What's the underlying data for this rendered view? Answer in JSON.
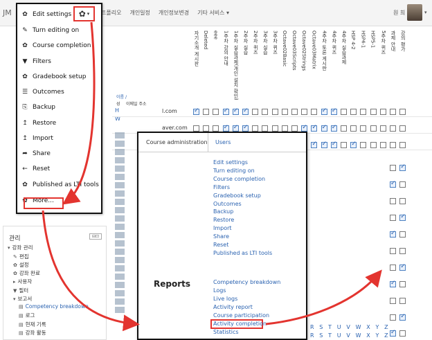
{
  "topbar": {
    "brand": "JM",
    "nav": [
      "트폴리오",
      "개인일정",
      "개인정보변경",
      "기타 서비스 ▾"
    ],
    "user_name": "원 희",
    "caret": "▾"
  },
  "cog_button": {
    "icon": "gear-icon",
    "caret": "▾"
  },
  "cog_menu": [
    {
      "label": "Edit settings",
      "icon": "gear-icon",
      "glyph": "✿"
    },
    {
      "label": "Turn editing on",
      "icon": "pencil-icon",
      "glyph": "✎"
    },
    {
      "label": "Course completion",
      "icon": "gear-icon",
      "glyph": "✿"
    },
    {
      "label": "Filters",
      "icon": "filter-icon",
      "glyph": "▼"
    },
    {
      "label": "Gradebook setup",
      "icon": "gear-icon",
      "glyph": "✿"
    },
    {
      "label": "Outcomes",
      "icon": "list-icon",
      "glyph": "☰"
    },
    {
      "label": "Backup",
      "icon": "document-icon",
      "glyph": "⎘"
    },
    {
      "label": "Restore",
      "icon": "upload-icon",
      "glyph": "↥"
    },
    {
      "label": "Import",
      "icon": "import-icon",
      "glyph": "↥"
    },
    {
      "label": "Share",
      "icon": "share-icon",
      "glyph": "➦"
    },
    {
      "label": "Reset",
      "icon": "reset-icon",
      "glyph": "←"
    },
    {
      "label": "Published as LTI tools",
      "icon": "gear-icon",
      "glyph": "✿"
    },
    {
      "label": "More...",
      "icon": "gear-icon",
      "glyph": "✿"
    }
  ],
  "side_block": {
    "title": "관리",
    "controls": "⊟⊡",
    "items": [
      {
        "label": "강좌 관리",
        "icon": "caret-down-icon",
        "glyph": "▾",
        "indent": 0,
        "link": false
      },
      {
        "label": "편집",
        "icon": "pencil-icon",
        "glyph": "✎",
        "indent": 1,
        "link": false
      },
      {
        "label": "설정",
        "icon": "gear-icon",
        "glyph": "✿",
        "indent": 1,
        "link": false
      },
      {
        "label": "강좌 완료",
        "icon": "gear-icon",
        "glyph": "✿",
        "indent": 1,
        "link": false
      },
      {
        "label": "사용자",
        "icon": "caret-right-icon",
        "glyph": "▸",
        "indent": 1,
        "link": false
      },
      {
        "label": "필터",
        "icon": "filter-icon",
        "glyph": "▼",
        "indent": 1,
        "link": false
      },
      {
        "label": "보고서",
        "icon": "caret-down-icon",
        "glyph": "▾",
        "indent": 1,
        "link": false
      },
      {
        "label": "Competency breakdown",
        "icon": "report-icon",
        "glyph": "▤",
        "indent": 2,
        "link": true
      },
      {
        "label": "로그",
        "icon": "report-icon",
        "glyph": "▤",
        "indent": 2,
        "link": false
      },
      {
        "label": "현재 기록",
        "icon": "report-icon",
        "glyph": "▤",
        "indent": 2,
        "link": false
      },
      {
        "label": "강좌 활동",
        "icon": "report-icon",
        "glyph": "▤",
        "indent": 2,
        "link": false
      }
    ]
  },
  "admin_panel": {
    "tab_active": "Course administration",
    "tab_other": "Users",
    "course_links": [
      "Edit settings",
      "Turn editing on",
      "Course completion",
      "Filters",
      "Gradebook setup",
      "Outcomes",
      "Backup",
      "Restore",
      "Import",
      "Share",
      "Reset",
      "Published as LTI tools"
    ],
    "reports_heading": "Reports",
    "report_links": [
      "Competency breakdown",
      "Logs",
      "Live logs",
      "Activity report",
      "Course participation",
      "Activity completion",
      "Statistics"
    ]
  },
  "grader": {
    "sort_label": "이름 /",
    "col_name": "성",
    "col_email": "이메일 주소",
    "row_label_1": "H",
    "row_label_2": "W",
    "email_1": "l.com",
    "email_2": "aver.com",
    "column_headers": [
      "자기소개 게시판",
      "Deleted",
      "eee",
      "1주차 강의 안내",
      "1주차 실습과제(개인 설치 확인)",
      "2주차 실습",
      "2주차 퀴즈",
      "3주차 실습",
      "3주차 퀴즈",
      "Octave02Basic",
      "Octave03Scripts",
      "Octave02Strings",
      "Octave03Matrix",
      "4주차 토론 게시판",
      "4주차 퀴즈",
      "4주차 실습과제",
      "HSP 4-2",
      "HSP4-1",
      "HSP5-1",
      "5주차 퀴즈",
      "과제 안내",
      "강의 평가"
    ]
  },
  "alphabet": {
    "row1": "R S T U V W X Y Z",
    "row2": "R S T U V W X Y Z"
  }
}
